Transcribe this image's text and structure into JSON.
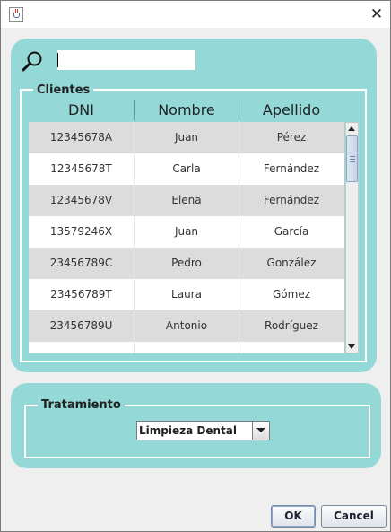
{
  "window": {
    "title": ""
  },
  "search": {
    "value": "",
    "placeholder": ""
  },
  "clients": {
    "title": "Clientes",
    "columns": [
      "DNI",
      "Nombre",
      "Apellido"
    ],
    "rows": [
      [
        "12345678A",
        "Juan",
        "Pérez"
      ],
      [
        "12345678T",
        "Carla",
        "Fernández"
      ],
      [
        "12345678V",
        "Elena",
        "Fernández"
      ],
      [
        "13579246X",
        "Juan",
        "García"
      ],
      [
        "23456789C",
        "Pedro",
        "González"
      ],
      [
        "23456789T",
        "Laura",
        "Gómez"
      ],
      [
        "23456789U",
        "Antonio",
        "Rodríguez"
      ],
      [
        "",
        "",
        ""
      ]
    ]
  },
  "treatment": {
    "title": "Tratamiento",
    "selected": "Limpieza Dental"
  },
  "buttons": {
    "ok": "OK",
    "cancel": "Cancel"
  },
  "colors": {
    "panel": "#94d8d8",
    "row_alt": "#dcdcdc",
    "border": "#ffffff"
  }
}
